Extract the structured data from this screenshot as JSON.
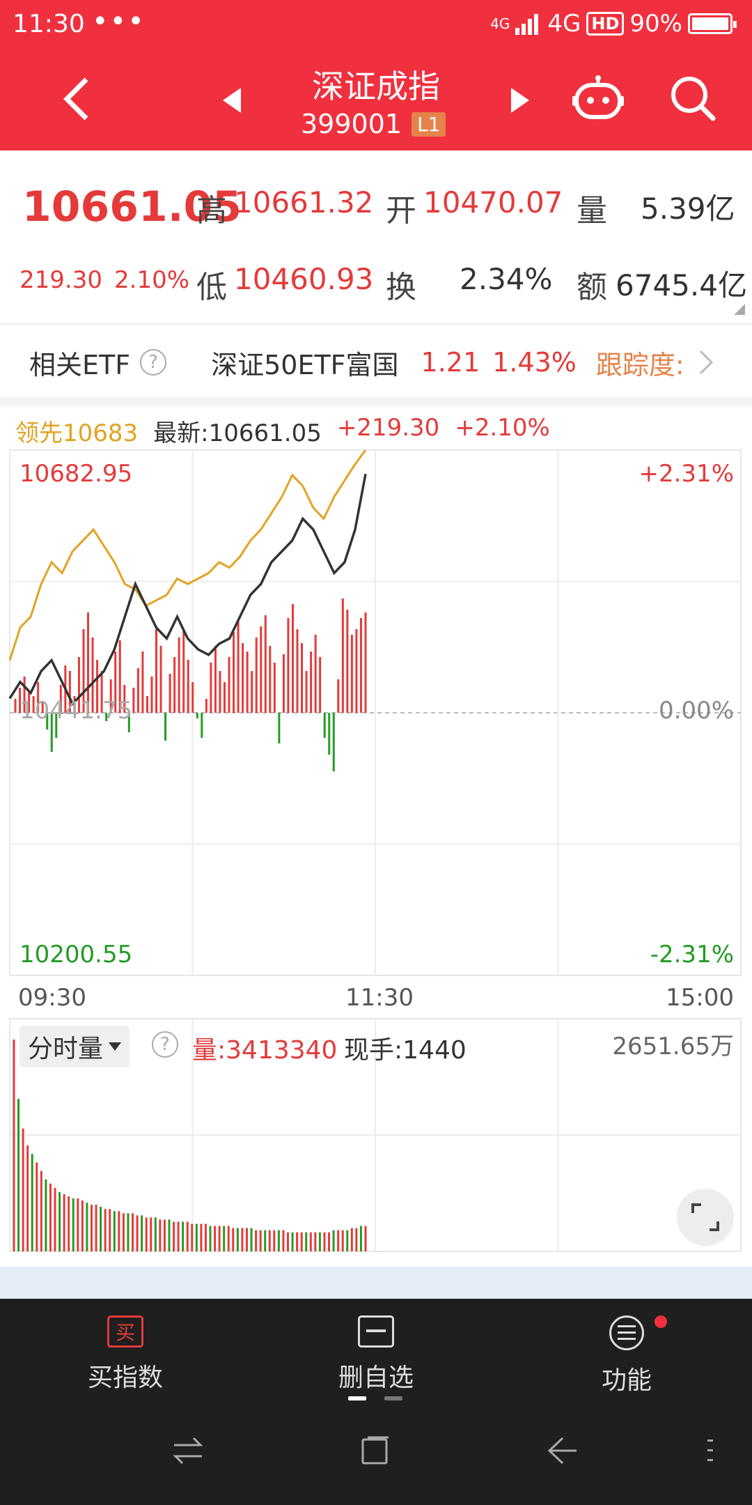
{
  "status_bar": {
    "time": "11:30",
    "dots": "•••",
    "network": "4G",
    "signal_label": "4G",
    "hd": "HD",
    "battery": "90%"
  },
  "header": {
    "title": "深证成指",
    "code": "399001",
    "level": "L1"
  },
  "quote": {
    "price": "10661.05",
    "change": "219.30",
    "change_pct": "2.10%",
    "high_label": "高",
    "high": "10661.32",
    "open_label": "开",
    "open": "10470.07",
    "vol_label": "量",
    "vol": "5.39亿",
    "low_label": "低",
    "low": "10460.93",
    "turnover_label": "换",
    "turnover": "2.34%",
    "amount_label": "额",
    "amount": "6745.4亿"
  },
  "etf": {
    "label": "相关ETF",
    "help": "?",
    "name": "深证50ETF富国",
    "price": "1.21",
    "pct": "1.43%",
    "tracking": "跟踪度:"
  },
  "legend": {
    "lead": "领先10683",
    "latest": "最新:10661.05",
    "change": "+219.30",
    "pct": "+2.10%"
  },
  "chart_labels": {
    "y_top": "10682.95",
    "y_mid": "10441.75",
    "y_bottom": "10200.55",
    "pct_top": "+2.31%",
    "pct_mid": "0.00%",
    "pct_bottom": "-2.31%",
    "t_start": "09:30",
    "t_mid": "11:30",
    "t_end": "15:00"
  },
  "volume_panel": {
    "selector": "分时量",
    "help": "?",
    "vol": "量:3413340",
    "hand": "现手:1440",
    "max": "2651.65万"
  },
  "bottom_nav": {
    "buy_icon": "买",
    "buy": "买指数",
    "remove": "删自选",
    "func": "功能"
  },
  "colors": {
    "header": "#f0303e",
    "up": "#e43a3a",
    "down": "#239b23",
    "lead_line": "#e2a321",
    "price_line": "#333333"
  },
  "chart_data": {
    "type": "line",
    "x": [
      "09:30",
      "11:30",
      "15:00"
    ],
    "ylim": [
      10200.55,
      10682.95
    ],
    "y_reference": 10441.75,
    "series": [
      {
        "name": "领先",
        "values": [
          10490,
          10520,
          10530,
          10560,
          10580,
          10570,
          10590,
          10600,
          10610,
          10595,
          10580,
          10560,
          10555,
          10540,
          10545,
          10550,
          10565,
          10560,
          10565,
          10570,
          10580,
          10575,
          10585,
          10600,
          10610,
          10625,
          10640,
          10660,
          10650,
          10630,
          10620,
          10640,
          10655,
          10670,
          10683
        ]
      },
      {
        "name": "最新",
        "values": [
          10455,
          10470,
          10460,
          10480,
          10490,
          10470,
          10450,
          10460,
          10470,
          10480,
          10500,
          10530,
          10560,
          10540,
          10520,
          10510,
          10530,
          10510,
          10500,
          10495,
          10505,
          10510,
          10530,
          10550,
          10560,
          10580,
          10590,
          10600,
          10620,
          10610,
          10590,
          10570,
          10580,
          10610,
          10661.05
        ]
      }
    ],
    "diff_bars": [
      10,
      18,
      26,
      16,
      12,
      22,
      8,
      -12,
      -28,
      -18,
      20,
      34,
      30,
      12,
      40,
      60,
      72,
      54,
      38,
      30,
      -6,
      24,
      44,
      52,
      20,
      -14,
      18,
      32,
      44,
      12,
      26,
      60,
      48,
      -20,
      28,
      40,
      54,
      60,
      38,
      22,
      -4,
      -18,
      10,
      36,
      48,
      30,
      22,
      40,
      58,
      66,
      50,
      44,
      30,
      54,
      62,
      70,
      48,
      36,
      -22,
      42,
      68,
      78,
      60,
      50,
      30,
      44,
      56,
      40,
      -18,
      -30,
      -42,
      24,
      82,
      74,
      56,
      60,
      68,
      72
    ],
    "volume_bars": [
      100,
      72,
      58,
      50,
      46,
      42,
      38,
      34,
      32,
      30,
      28,
      27,
      26,
      25,
      25,
      24,
      23,
      22,
      22,
      21,
      20,
      20,
      19,
      19,
      18,
      18,
      18,
      17,
      17,
      16,
      16,
      16,
      15,
      15,
      15,
      14,
      14,
      14,
      14,
      13,
      13,
      13,
      13,
      12,
      12,
      12,
      12,
      12,
      11,
      11,
      11,
      11,
      11,
      10,
      10,
      10,
      10,
      10,
      10,
      10,
      9,
      9,
      9,
      9,
      9,
      9,
      9,
      9,
      9,
      9,
      10,
      10,
      10,
      10,
      11,
      11,
      12,
      12
    ]
  }
}
